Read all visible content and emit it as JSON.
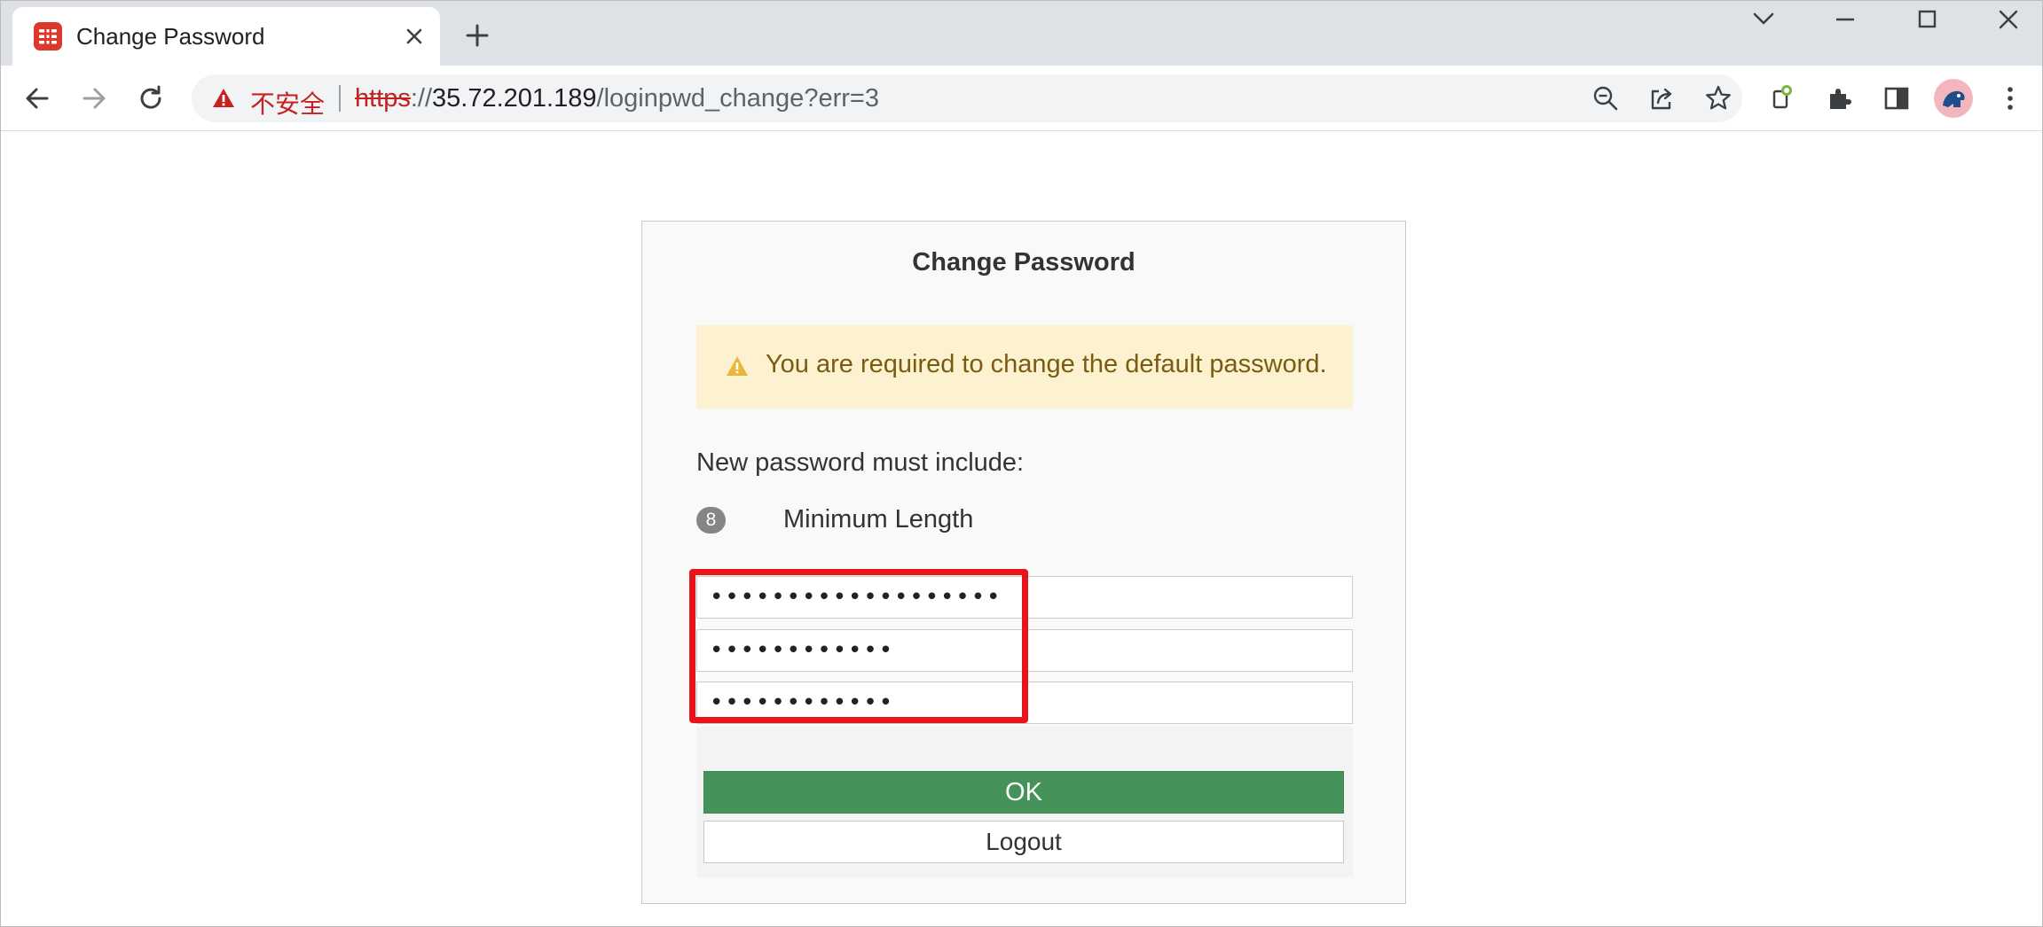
{
  "browser": {
    "tab_title": "Change Password",
    "address": {
      "security_label": "不安全",
      "scheme": "https",
      "separator": "://",
      "host": "35.72.201.189",
      "path": "/loginpwd_change?err=3"
    }
  },
  "dialog": {
    "title": "Change Password",
    "alert_text": "You are required to change the default password.",
    "requirements_title": "New password must include:",
    "requirement": {
      "badge": "8",
      "label": "Minimum Length"
    },
    "fields": {
      "old_password_masked": "•••••••••••••••••••",
      "new_password_masked": "••••••••••••",
      "confirm_password_masked": "••••••••••••"
    },
    "ok_label": "OK",
    "logout_label": "Logout"
  },
  "colors": {
    "ok_button": "#45935a",
    "alert_background": "#fcf2cf",
    "highlight_box": "#e8141c",
    "insecure_text": "#c5221f"
  }
}
